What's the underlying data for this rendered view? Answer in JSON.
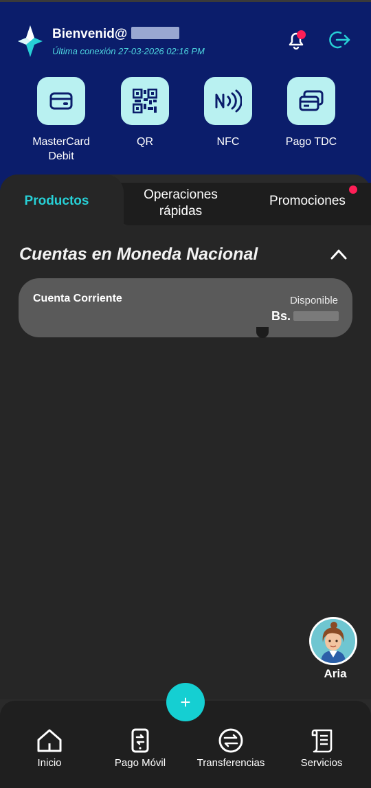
{
  "header": {
    "welcome": "Bienvenid@",
    "last_login": "Última conexión 27-03-2026 02:16 PM",
    "icons": {
      "logo": "brand-star-icon",
      "bell": "bell-icon",
      "logout": "logout-icon"
    },
    "notification_color": "#ff1f57"
  },
  "quick_actions": [
    {
      "label": "MasterCard Debit",
      "icon": "card-icon"
    },
    {
      "label": "QR",
      "icon": "qr-icon"
    },
    {
      "label": "NFC",
      "icon": "nfc-icon"
    },
    {
      "label": "Pago TDC",
      "icon": "cards-stack-icon"
    }
  ],
  "tabs": [
    {
      "label": "Productos",
      "active": true
    },
    {
      "label": "Operaciones rápidas",
      "active": false
    },
    {
      "label": "Promociones",
      "active": false
    }
  ],
  "section": {
    "title": "Cuentas en Moneda Nacional",
    "collapse_icon": "chevron-up-icon"
  },
  "account": {
    "name": "Cuenta Corriente",
    "available_label": "Disponible",
    "currency": "Bs."
  },
  "assistant": {
    "name": "Aria",
    "icon": "assistant-avatar"
  },
  "fab": {
    "label": "+"
  },
  "bottom_nav": [
    {
      "label": "Inicio",
      "icon": "home-icon"
    },
    {
      "label": "Pago Móvil",
      "icon": "mobile-payment-icon"
    },
    {
      "label": "Transferencias",
      "icon": "transfer-icon"
    },
    {
      "label": "Servicios",
      "icon": "services-receipt-icon"
    }
  ],
  "colors": {
    "header_bg": "#0b1d6b",
    "accent": "#27d0d6",
    "tile_bg": "#b9f1f1",
    "background": "#262626"
  }
}
